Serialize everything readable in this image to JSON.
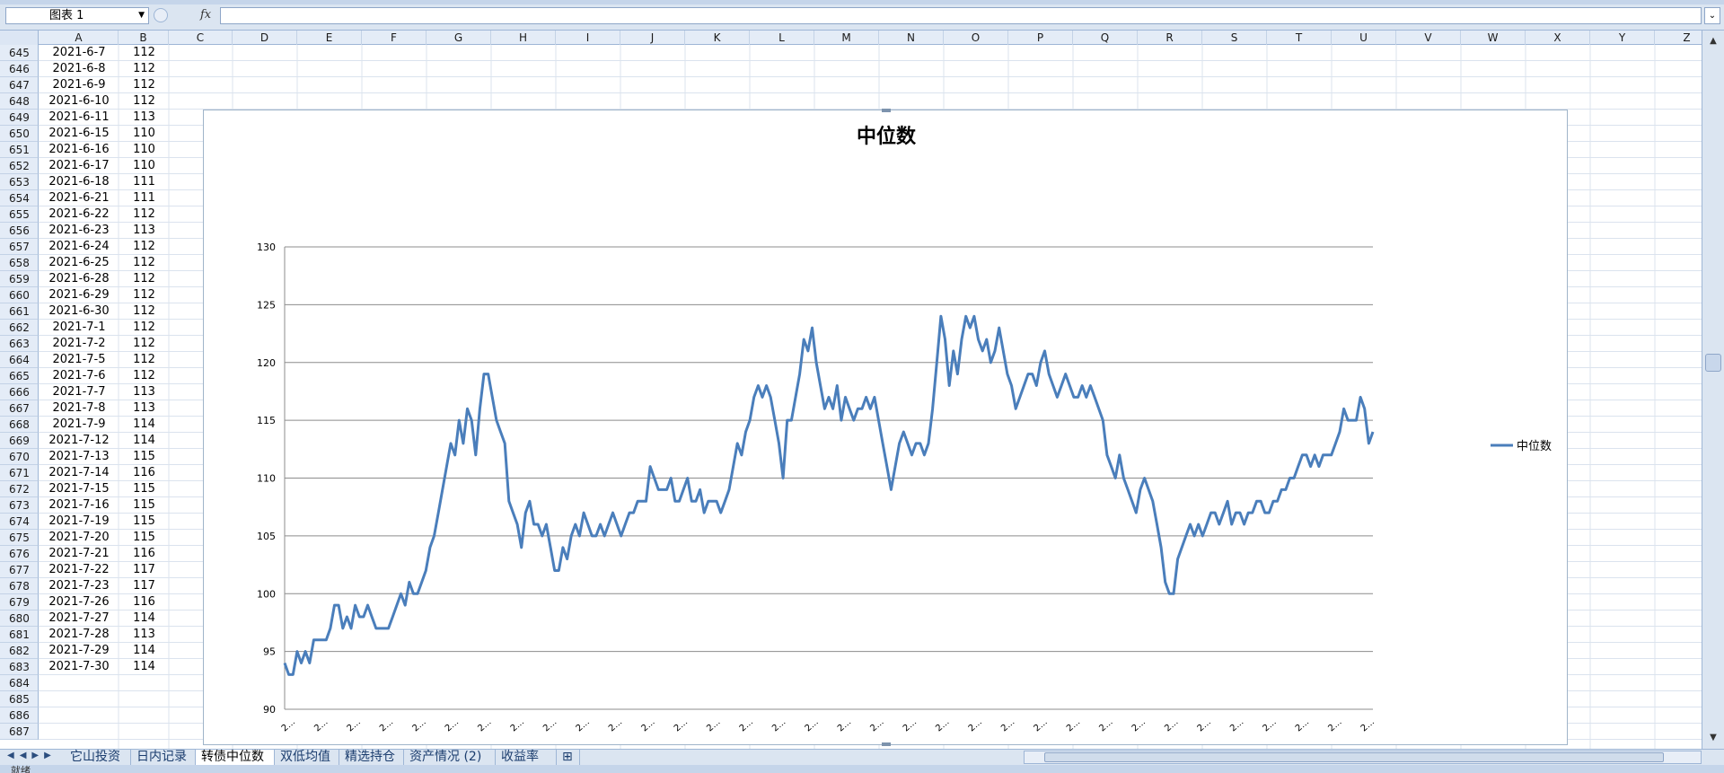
{
  "formula_bar": {
    "name_box": "图表 1",
    "fx_label": "fx",
    "formula": ""
  },
  "columns": [
    "A",
    "B",
    "C",
    "D",
    "E",
    "F",
    "G",
    "H",
    "I",
    "J",
    "K",
    "L",
    "M",
    "N",
    "O",
    "P",
    "Q",
    "R",
    "S",
    "T",
    "U",
    "V",
    "W",
    "X",
    "Y",
    "Z"
  ],
  "rows": [
    {
      "n": "645",
      "date": "2021-6-7",
      "value": "112"
    },
    {
      "n": "646",
      "date": "2021-6-8",
      "value": "112"
    },
    {
      "n": "647",
      "date": "2021-6-9",
      "value": "112"
    },
    {
      "n": "648",
      "date": "2021-6-10",
      "value": "112"
    },
    {
      "n": "649",
      "date": "2021-6-11",
      "value": "113"
    },
    {
      "n": "650",
      "date": "2021-6-15",
      "value": "110"
    },
    {
      "n": "651",
      "date": "2021-6-16",
      "value": "110"
    },
    {
      "n": "652",
      "date": "2021-6-17",
      "value": "110"
    },
    {
      "n": "653",
      "date": "2021-6-18",
      "value": "111"
    },
    {
      "n": "654",
      "date": "2021-6-21",
      "value": "111"
    },
    {
      "n": "655",
      "date": "2021-6-22",
      "value": "112"
    },
    {
      "n": "656",
      "date": "2021-6-23",
      "value": "113"
    },
    {
      "n": "657",
      "date": "2021-6-24",
      "value": "112"
    },
    {
      "n": "658",
      "date": "2021-6-25",
      "value": "112"
    },
    {
      "n": "659",
      "date": "2021-6-28",
      "value": "112"
    },
    {
      "n": "660",
      "date": "2021-6-29",
      "value": "112"
    },
    {
      "n": "661",
      "date": "2021-6-30",
      "value": "112"
    },
    {
      "n": "662",
      "date": "2021-7-1",
      "value": "112"
    },
    {
      "n": "663",
      "date": "2021-7-2",
      "value": "112"
    },
    {
      "n": "664",
      "date": "2021-7-5",
      "value": "112"
    },
    {
      "n": "665",
      "date": "2021-7-6",
      "value": "112"
    },
    {
      "n": "666",
      "date": "2021-7-7",
      "value": "113"
    },
    {
      "n": "667",
      "date": "2021-7-8",
      "value": "113"
    },
    {
      "n": "668",
      "date": "2021-7-9",
      "value": "114"
    },
    {
      "n": "669",
      "date": "2021-7-12",
      "value": "114"
    },
    {
      "n": "670",
      "date": "2021-7-13",
      "value": "115"
    },
    {
      "n": "671",
      "date": "2021-7-14",
      "value": "116"
    },
    {
      "n": "672",
      "date": "2021-7-15",
      "value": "115"
    },
    {
      "n": "673",
      "date": "2021-7-16",
      "value": "115"
    },
    {
      "n": "674",
      "date": "2021-7-19",
      "value": "115"
    },
    {
      "n": "675",
      "date": "2021-7-20",
      "value": "115"
    },
    {
      "n": "676",
      "date": "2021-7-21",
      "value": "116"
    },
    {
      "n": "677",
      "date": "2021-7-22",
      "value": "117"
    },
    {
      "n": "678",
      "date": "2021-7-23",
      "value": "117"
    },
    {
      "n": "679",
      "date": "2021-7-26",
      "value": "116"
    },
    {
      "n": "680",
      "date": "2021-7-27",
      "value": "114"
    },
    {
      "n": "681",
      "date": "2021-7-28",
      "value": "113"
    },
    {
      "n": "682",
      "date": "2021-7-29",
      "value": "114"
    },
    {
      "n": "683",
      "date": "2021-7-30",
      "value": "114"
    },
    {
      "n": "684",
      "date": "",
      "value": ""
    },
    {
      "n": "685",
      "date": "",
      "value": ""
    },
    {
      "n": "686",
      "date": "",
      "value": ""
    },
    {
      "n": "687",
      "date": "",
      "value": ""
    }
  ],
  "sheet_tabs": [
    "它山投资",
    "日内记录",
    "转债中位数",
    "双低均值",
    "精选持仓",
    "资产情况 (2)",
    "收益率"
  ],
  "active_tab": 2,
  "status": {
    "text": "就绪"
  },
  "colors": {
    "series": "#4a7ebb",
    "gridline": "#8c8c8c"
  },
  "chart_data": {
    "type": "line",
    "title": "中位数",
    "xlabel": "",
    "ylabel": "",
    "ylim": [
      90,
      130
    ],
    "yticks": [
      "90",
      "95",
      "100",
      "105",
      "110",
      "115",
      "120",
      "125",
      "130"
    ],
    "xtick_label": "2...",
    "grid": true,
    "legend_position": "right",
    "series": [
      {
        "name": "中位数",
        "values": [
          94,
          93,
          93,
          95,
          94,
          95,
          94,
          96,
          96,
          96,
          96,
          97,
          99,
          99,
          97,
          98,
          97,
          99,
          98,
          98,
          99,
          98,
          97,
          97,
          97,
          97,
          98,
          99,
          100,
          99,
          101,
          100,
          100,
          101,
          102,
          104,
          105,
          107,
          109,
          111,
          113,
          112,
          115,
          113,
          116,
          115,
          112,
          116,
          119,
          119,
          117,
          115,
          114,
          113,
          108,
          107,
          106,
          104,
          107,
          108,
          106,
          106,
          105,
          106,
          104,
          102,
          102,
          104,
          103,
          105,
          106,
          105,
          107,
          106,
          105,
          105,
          106,
          105,
          106,
          107,
          106,
          105,
          106,
          107,
          107,
          108,
          108,
          108,
          111,
          110,
          109,
          109,
          109,
          110,
          108,
          108,
          109,
          110,
          108,
          108,
          109,
          107,
          108,
          108,
          108,
          107,
          108,
          109,
          111,
          113,
          112,
          114,
          115,
          117,
          118,
          117,
          118,
          117,
          115,
          113,
          110,
          115,
          115,
          117,
          119,
          122,
          121,
          123,
          120,
          118,
          116,
          117,
          116,
          118,
          115,
          117,
          116,
          115,
          116,
          116,
          117,
          116,
          117,
          115,
          113,
          111,
          109,
          111,
          113,
          114,
          113,
          112,
          113,
          113,
          112,
          113,
          116,
          120,
          124,
          122,
          118,
          121,
          119,
          122,
          124,
          123,
          124,
          122,
          121,
          122,
          120,
          121,
          123,
          121,
          119,
          118,
          116,
          117,
          118,
          119,
          119,
          118,
          120,
          121,
          119,
          118,
          117,
          118,
          119,
          118,
          117,
          117,
          118,
          117,
          118,
          117,
          116,
          115,
          112,
          111,
          110,
          112,
          110,
          109,
          108,
          107,
          109,
          110,
          109,
          108,
          106,
          104,
          101,
          100,
          100,
          103,
          104,
          105,
          106,
          105,
          106,
          105,
          106,
          107,
          107,
          106,
          107,
          108,
          106,
          107,
          107,
          106,
          107,
          107,
          108,
          108,
          107,
          107,
          108,
          108,
          109,
          109,
          110,
          110,
          111,
          112,
          112,
          111,
          112,
          111,
          112,
          112,
          112,
          113,
          114,
          116,
          115,
          115,
          115,
          117,
          116,
          113,
          114
        ]
      }
    ]
  }
}
